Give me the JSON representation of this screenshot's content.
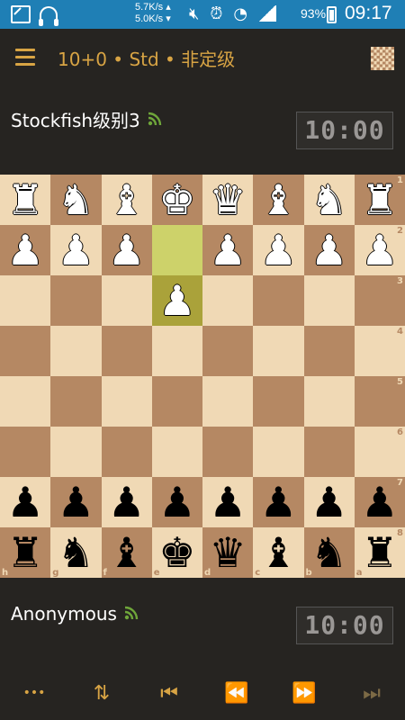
{
  "status_bar": {
    "speed_up": "5.7K/s ▴",
    "speed_down": "5.0K/s ▾",
    "battery": "93%",
    "time": "09:17",
    "icons": [
      "app-icon",
      "headset-icon",
      "mute-icon",
      "alarm-icon",
      "wifi-icon",
      "signal-icon",
      "battery-icon"
    ]
  },
  "header": {
    "title": "10+0 • Std • 非定级"
  },
  "opponent": {
    "name": "Stockfish级别3",
    "clock": "10:00"
  },
  "player": {
    "name": "Anonymous",
    "clock": "10:00"
  },
  "board": {
    "orientation": "black-bottom",
    "rows": [
      [
        "wR",
        "wN",
        "wB",
        "wK",
        "wQ",
        "wB",
        "wN",
        "wR"
      ],
      [
        "wP",
        "wP",
        "wP",
        "",
        "wP",
        "wP",
        "wP",
        "wP"
      ],
      [
        "",
        "",
        "",
        "wP",
        "",
        "",
        "",
        ""
      ],
      [
        "",
        "",
        "",
        "",
        "",
        "",
        "",
        ""
      ],
      [
        "",
        "",
        "",
        "",
        "",
        "",
        "",
        ""
      ],
      [
        "",
        "",
        "",
        "",
        "",
        "",
        "",
        ""
      ],
      [
        "bP",
        "bP",
        "bP",
        "bP",
        "bP",
        "bP",
        "bP",
        "bP"
      ],
      [
        "bR",
        "bN",
        "bB",
        "bK",
        "bQ",
        "bB",
        "bN",
        "bR"
      ]
    ],
    "ranks": [
      "1",
      "2",
      "3",
      "4",
      "5",
      "6",
      "7",
      "8"
    ],
    "files": [
      "h",
      "g",
      "f",
      "e",
      "d",
      "c",
      "b",
      "a"
    ],
    "last_move_from": [
      1,
      3
    ],
    "last_move_to": [
      2,
      3
    ]
  },
  "bottom_bar": {
    "more_label": "•••",
    "flip_label": "⇅",
    "first_label": "⏮",
    "prev_label": "⏪",
    "next_label": "⏩",
    "last_label": "⏭"
  },
  "colors": {
    "accent": "#d8a444",
    "light_square": "#f0d9b5",
    "dark_square": "#b58863",
    "status_bar": "#1f7fb5"
  }
}
